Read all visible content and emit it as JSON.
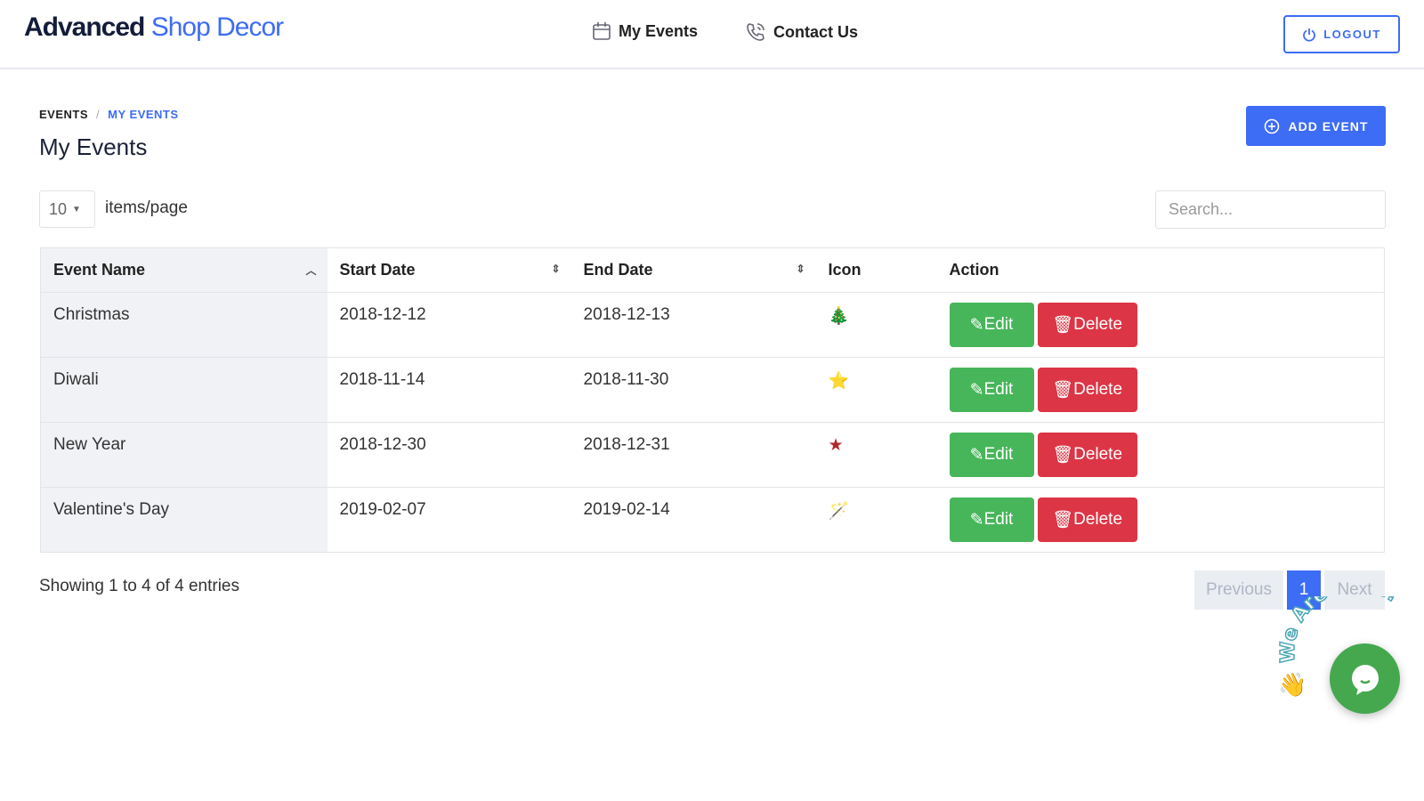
{
  "header": {
    "brand_bold": "Advanced",
    "brand_light": "Shop Decor",
    "nav": [
      {
        "label": "My Events",
        "icon": "calendar-icon"
      },
      {
        "label": "Contact Us",
        "icon": "phone-icon"
      }
    ],
    "logout": "LOGOUT"
  },
  "breadcrumb": {
    "items": [
      "EVENTS",
      "MY EVENTS"
    ]
  },
  "page_title": "My Events",
  "add_event": "ADD EVENT",
  "per_page": {
    "value": "10",
    "label": "items/page"
  },
  "search": {
    "placeholder": "Search...",
    "value": ""
  },
  "table": {
    "columns": [
      "Event Name",
      "Start Date",
      "End Date",
      "Icon",
      "Action"
    ],
    "rows": [
      {
        "name": "Christmas",
        "start": "2018-12-12",
        "end": "2018-12-13",
        "icon": "🎄"
      },
      {
        "name": "Diwali",
        "start": "2018-11-14",
        "end": "2018-11-30",
        "icon": "⭐"
      },
      {
        "name": "New Year",
        "start": "2018-12-30",
        "end": "2018-12-31",
        "icon": "★"
      },
      {
        "name": "Valentine's Day",
        "start": "2019-02-07",
        "end": "2019-02-14",
        "icon": "🪄"
      }
    ],
    "edit_label": "Edit",
    "delete_label": "Delete"
  },
  "footer": {
    "info": "Showing 1 to 4 of 4 entries",
    "previous": "Previous",
    "page": "1",
    "next": "Next"
  },
  "chat_widget": {
    "text": "We Are Here!"
  },
  "colors": {
    "primary": "#3d6cf5",
    "edit": "#47b65a",
    "delete": "#dc3545",
    "chat": "#45a84f"
  }
}
